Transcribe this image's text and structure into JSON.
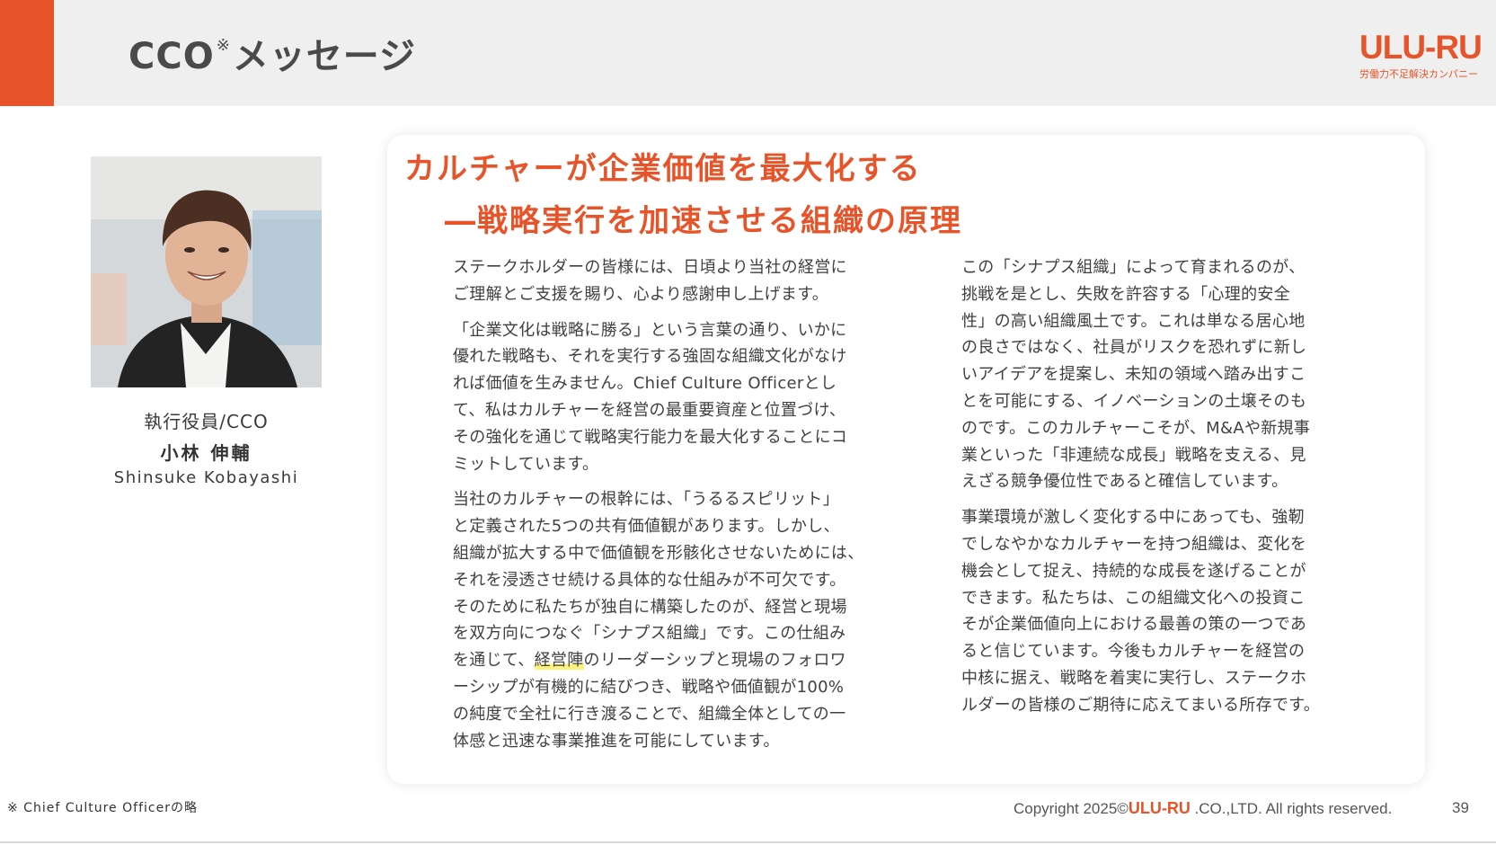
{
  "header": {
    "title_prefix": "CCO",
    "title_mark": "※",
    "title_suffix": "メッセージ",
    "accent_color": "#e8542a"
  },
  "brand": {
    "logo": "ULU-RU",
    "tagline": "労働力不足解決カンパニー"
  },
  "profile": {
    "role": "執行役員/CCO",
    "name_jp": "小林 伸輔",
    "name_en": "Shinsuke Kobayashi"
  },
  "message": {
    "headline": "カルチャーが企業価値を最大化する",
    "subheadline": "―戦略実行を加速させる組織の原理",
    "left_paragraphs": {
      "p1": "ステークホルダーの皆様には、日頃より当社の経営に\nご理解とご支援を賜り、心より感謝申し上げます。",
      "p2": "「企業文化は戦略に勝る」という言葉の通り、いかに\n優れた戦略も、それを実行する強固な組織文化がなけ\nれば価値を生みません。Chief Culture Officerとし\nて、私はカルチャーを経営の最重要資産と位置づけ、\nその強化を通じて戦略実行能力を最大化することにコ\nミットしています。",
      "p3_before": "当社のカルチャーの根幹には、「うるるスピリット」\nと定義された5つの共有価値観があります。しかし、\n組織が拡大する中で価値観を形骸化させないためには、\nそれを浸透させ続ける具体的な仕組みが不可欠です。\nそのために私たちが独自に構築したのが、経営と現場\nを双方向につなぐ「シナプス組織」です。この仕組み\nを通じて、",
      "p3_highlight": "経営陣",
      "p3_after": "のリーダーシップと現場のフォロワ\nーシップが有機的に結びつき、戦略や価値観が100%\nの純度で全社に行き渡ることで、組織全体としての一\n体感と迅速な事業推進を可能にしています。"
    },
    "right_paragraphs": {
      "p1": "この「シナプス組織」によって育まれるのが、\n挑戦を是とし、失敗を許容する「心理的安全\n性」の高い組織風土です。これは単なる居心地\nの良さではなく、社員がリスクを恐れずに新し\nいアイデアを提案し、未知の領域へ踏み出すこ\nとを可能にする、イノベーションの土壌そのも\nのです。このカルチャーこそが、M&Aや新規事\n業といった「非連続な成長」戦略を支える、見\nえざる競争優位性であると確信しています。",
      "p2": "事業環境が激しく変化する中にあっても、強靭\nでしなやかなカルチャーを持つ組織は、変化を\n機会として捉え、持続的な成長を遂げることが\nできます。私たちは、この組織文化への投資こ\nそが企業価値向上における最善の策の一つであ\nると信じています。今後もカルチャーを経営の\n中核に据え、戦略を着実に実行し、ステークホ\nルダーの皆様のご期待に応えてまいる所存です。"
    }
  },
  "footer": {
    "footnote": "※ Chief Culture Officerの略",
    "copyright_prefix": "Copyright 2025©",
    "copyright_logo": "ULU-RU",
    "copyright_suffix": " .CO.,LTD. All rights reserved.",
    "page_number": "39"
  }
}
